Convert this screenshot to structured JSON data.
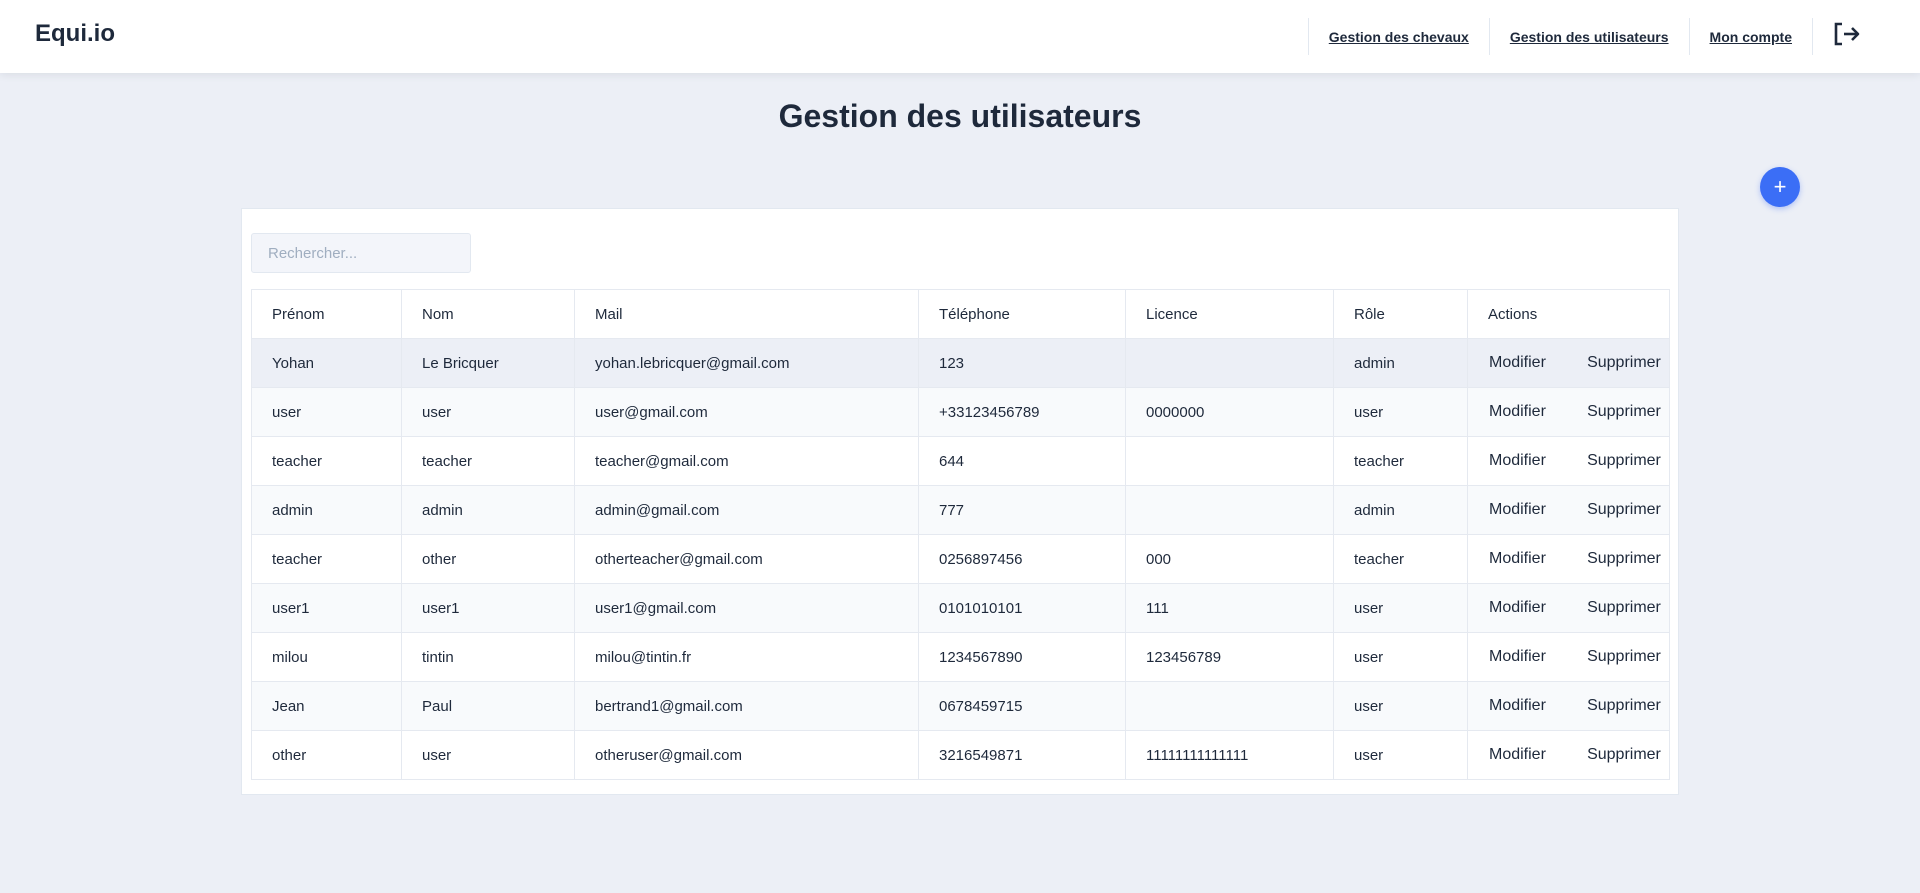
{
  "app": {
    "brand": "Equi.io"
  },
  "nav": {
    "links": [
      {
        "label": "Gestion des chevaux"
      },
      {
        "label": "Gestion des utilisateurs"
      },
      {
        "label": "Mon compte"
      }
    ],
    "logout_icon": "logout-icon"
  },
  "page": {
    "title": "Gestion des utilisateurs"
  },
  "add_button": {
    "icon": "plus-icon",
    "label": "+",
    "color": "#3b6ef6"
  },
  "search": {
    "placeholder": "Rechercher...",
    "value": ""
  },
  "table": {
    "headers": [
      "Prénom",
      "Nom",
      "Mail",
      "Téléphone",
      "Licence",
      "Rôle",
      "Actions"
    ],
    "action_labels": {
      "edit": "Modifier",
      "delete": "Supprimer"
    },
    "rows": [
      {
        "prenom": "Yohan",
        "nom": "Le Bricquer",
        "mail": "yohan.lebricquer@gmail.com",
        "telephone": "123",
        "licence": "",
        "role": "admin"
      },
      {
        "prenom": "user",
        "nom": "user",
        "mail": "user@gmail.com",
        "telephone": "+33123456789",
        "licence": "0000000",
        "role": "user"
      },
      {
        "prenom": "teacher",
        "nom": "teacher",
        "mail": "teacher@gmail.com",
        "telephone": "644",
        "licence": "",
        "role": "teacher"
      },
      {
        "prenom": "admin",
        "nom": "admin",
        "mail": "admin@gmail.com",
        "telephone": "777",
        "licence": "",
        "role": "admin"
      },
      {
        "prenom": "teacher",
        "nom": "other",
        "mail": "otherteacher@gmail.com",
        "telephone": "0256897456",
        "licence": "000",
        "role": "teacher"
      },
      {
        "prenom": "user1",
        "nom": "user1",
        "mail": "user1@gmail.com",
        "telephone": "0101010101",
        "licence": "111",
        "role": "user"
      },
      {
        "prenom": "milou",
        "nom": "tintin",
        "mail": "milou@tintin.fr",
        "telephone": "1234567890",
        "licence": "123456789",
        "role": "user"
      },
      {
        "prenom": "Jean",
        "nom": "Paul",
        "mail": "bertrand1@gmail.com",
        "telephone": "0678459715",
        "licence": "",
        "role": "user"
      },
      {
        "prenom": "other",
        "nom": "user",
        "mail": "otheruser@gmail.com",
        "telephone": "3216549871",
        "licence": "11111111111111",
        "role": "user"
      }
    ]
  },
  "colors": {
    "background": "#eceff6",
    "text": "#1e293b",
    "accent": "#3b6ef6"
  }
}
